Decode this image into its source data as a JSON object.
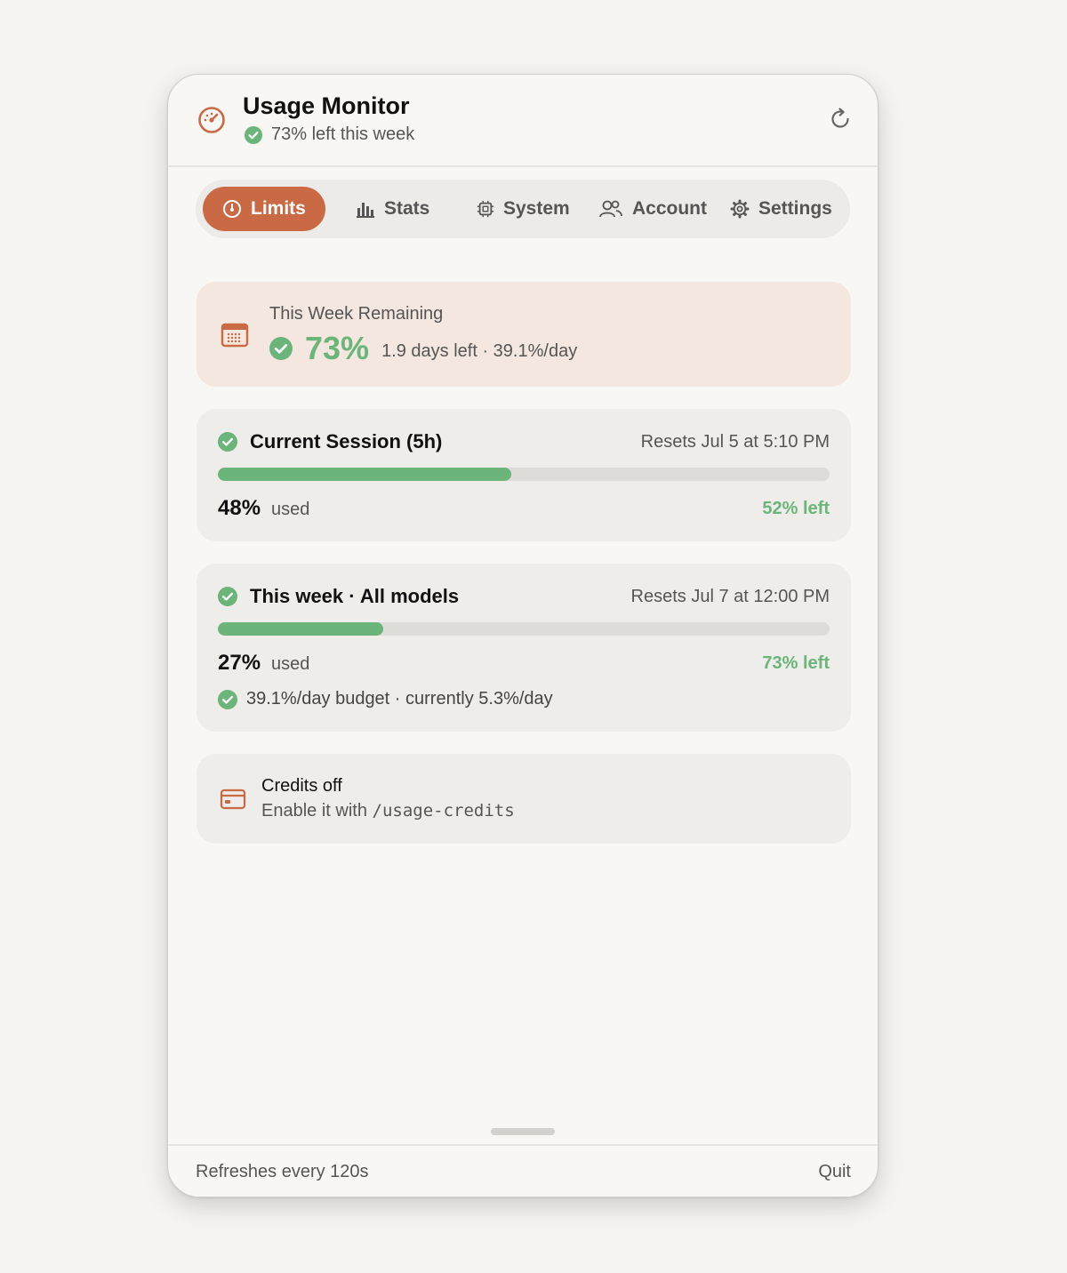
{
  "header": {
    "title": "Usage Monitor",
    "subtitle": "73% left this week",
    "icon": "gauge-icon"
  },
  "tabs": [
    {
      "label": "Limits",
      "icon": "gauge-icon",
      "active": true
    },
    {
      "label": "Stats",
      "icon": "bar-chart-icon",
      "active": false
    },
    {
      "label": "System",
      "icon": "cpu-icon",
      "active": false
    },
    {
      "label": "Account",
      "icon": "users-icon",
      "active": false
    },
    {
      "label": "Settings",
      "icon": "gear-icon",
      "active": false
    }
  ],
  "week_remaining": {
    "label": "This Week Remaining",
    "percent": "73%",
    "detail": "1.9 days left · 39.1%/day"
  },
  "session": {
    "title": "Current Session (5h)",
    "reset": "Resets Jul 5 at 5:10 PM",
    "used_pct": "48%",
    "used_label": "used",
    "left": "52% left",
    "fraction": 0.48
  },
  "week_all": {
    "title": "This week · All models",
    "reset": "Resets Jul 7 at 12:00 PM",
    "used_pct": "27%",
    "used_label": "used",
    "left": "73% left",
    "fraction": 0.27,
    "budget": "39.1%/day budget · currently 5.3%/day"
  },
  "credits": {
    "title": "Credits off",
    "sub_prefix": "Enable it with",
    "command": "/usage-credits"
  },
  "footer": {
    "refresh_text": "Refreshes every 120s",
    "quit_label": "Quit"
  },
  "colors": {
    "accent": "#c96a45",
    "success": "#6bb57a",
    "warm_card": "#f3e7df",
    "card": "#eeede9"
  }
}
